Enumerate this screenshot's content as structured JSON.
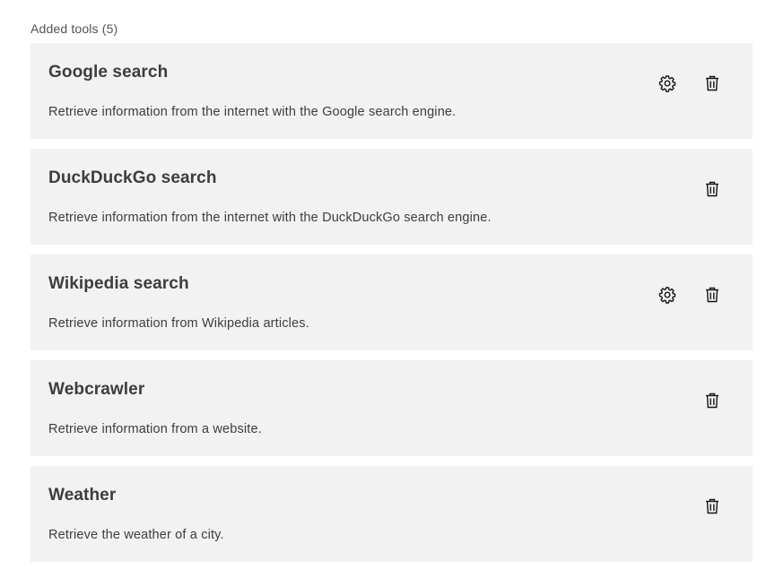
{
  "header": {
    "label": "Added tools (5)"
  },
  "tools": [
    {
      "name": "Google search",
      "description": "Retrieve information from the internet with the Google search engine.",
      "settings_icon": "gear-icon",
      "delete_icon": "trash-icon",
      "has_settings": true
    },
    {
      "name": "DuckDuckGo search",
      "description": "Retrieve information from the internet with the DuckDuckGo search engine.",
      "delete_icon": "trash-icon",
      "has_settings": false
    },
    {
      "name": "Wikipedia search",
      "description": "Retrieve information from Wikipedia articles.",
      "settings_icon": "gear-icon",
      "delete_icon": "trash-icon",
      "has_settings": true
    },
    {
      "name": "Webcrawler",
      "description": "Retrieve information from a website.",
      "delete_icon": "trash-icon",
      "has_settings": false
    },
    {
      "name": "Weather",
      "description": "Retrieve the weather of a city.",
      "delete_icon": "trash-icon",
      "has_settings": false
    }
  ],
  "colors": {
    "card_background": "#f2f2f2",
    "text_primary": "#3d3d3d",
    "text_label": "#525252"
  }
}
